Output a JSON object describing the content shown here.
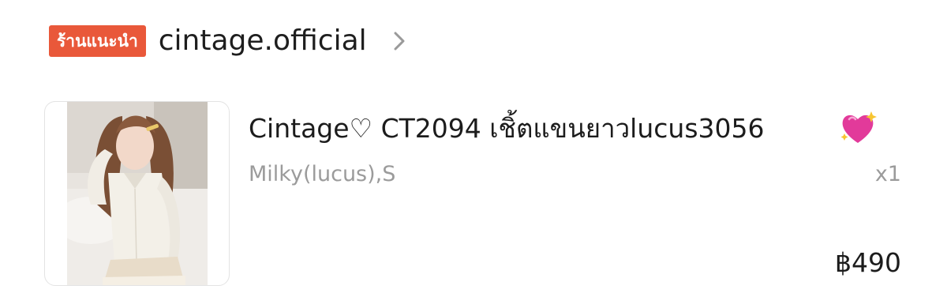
{
  "shop": {
    "badge": "ร้านแนะนำ",
    "name": "cintage.official",
    "chevron_icon": "chevron-right-icon"
  },
  "product": {
    "image_icon": "product-photo",
    "title": "Cintage♡ CT2094 เชิ้ตแขนยาวlucus3056",
    "emoji": "sparkling-heart-icon",
    "variant": "Milky(lucus),S",
    "quantity": "x1",
    "price": "฿490"
  },
  "colors": {
    "badge_bg": "#e9583a",
    "text_primary": "#1c1c1c",
    "text_secondary": "#9b9b9b"
  }
}
